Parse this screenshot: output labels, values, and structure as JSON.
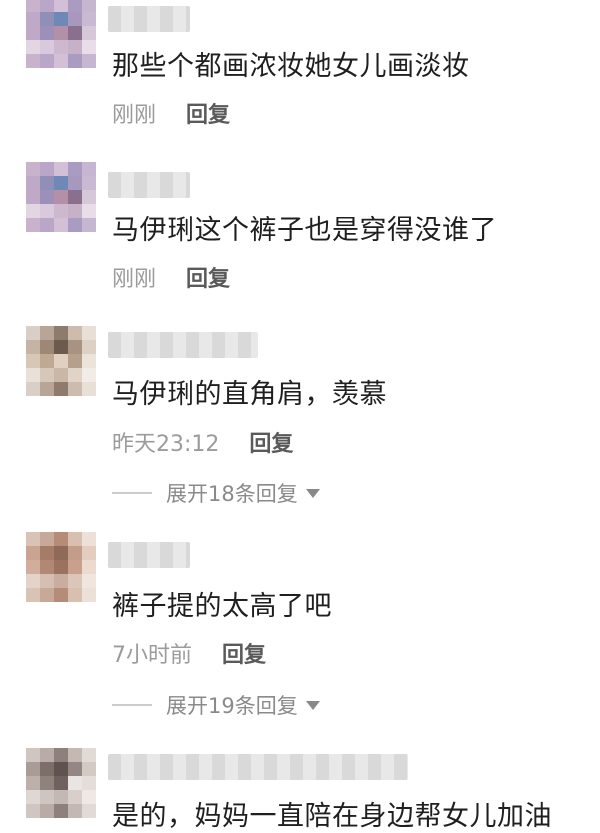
{
  "comments": [
    {
      "text": "那些个都画浓妆她女儿画淡妆",
      "time": "刚刚",
      "reply_label": "回复",
      "avatar_colors": [
        "#c9b3cc",
        "#b9a6c9",
        "#d3c0d6",
        "#a99bc2",
        "#c7b6cf",
        "#bfa9c8",
        "#8f8fb8",
        "#6e88b8",
        "#a998be",
        "#c9b9d2",
        "#c0a8c7",
        "#9c8fba",
        "#b48fa8",
        "#8a6f8f",
        "#d6c8d9",
        "#e3d6e3",
        "#d8c9dc",
        "#cdb8cf",
        "#c7b1c9",
        "#e8dde8"
      ]
    },
    {
      "text": "马伊琍这个裤子也是穿得没谁了",
      "time": "刚刚",
      "reply_label": "回复",
      "avatar_colors": [
        "#c9b3cc",
        "#b9a6c9",
        "#d3c0d6",
        "#a99bc2",
        "#c7b6cf",
        "#bfa9c8",
        "#8f8fb8",
        "#6e88b8",
        "#a998be",
        "#c9b9d2",
        "#c0a8c7",
        "#9c8fba",
        "#b48fa8",
        "#8a6f8f",
        "#d6c8d9",
        "#e3d6e3",
        "#d8c9dc",
        "#cdb8cf",
        "#c7b1c9",
        "#e8dde8"
      ]
    },
    {
      "text": "马伊琍的直角肩，羡慕",
      "time": "昨天23:12",
      "reply_label": "回复",
      "expand_label": "展开18条回复",
      "avatar_colors": [
        "#d9cfc6",
        "#b7a597",
        "#8f7b6c",
        "#cdbcad",
        "#e8dfd6",
        "#c5b3a3",
        "#9d8878",
        "#6d5a4e",
        "#a89282",
        "#ddd0c4",
        "#d8c6b6",
        "#bfa994",
        "#e1cfbf",
        "#b69f8b",
        "#ece3da",
        "#e9e1d9",
        "#d5c7ba",
        "#c9b8a8",
        "#e0d4c9",
        "#f2ece6"
      ]
    },
    {
      "text": "裤子提的太高了吧",
      "time": "7小时前",
      "reply_label": "回复",
      "expand_label": "展开19条回复",
      "avatar_colors": [
        "#d8c3b6",
        "#c7a99a",
        "#b48c78",
        "#d9bfb0",
        "#ece0d8",
        "#c9a493",
        "#a57c68",
        "#8f6a58",
        "#c49d8a",
        "#e2cdc0",
        "#d1ad9c",
        "#b28773",
        "#9b725f",
        "#c8a08c",
        "#eadad0",
        "#e3d3c8",
        "#d6bfb2",
        "#c9ad9e",
        "#dcc6b9",
        "#f1e6df"
      ]
    },
    {
      "text": "是的，妈妈一直陪在身边帮女儿加油",
      "avatar_colors": [
        "#d0c6c1",
        "#b9aca6",
        "#8e807a",
        "#c4b8b2",
        "#e2dad6",
        "#a99b95",
        "#7c6e69",
        "#5f5350",
        "#948682",
        "#d3c9c5",
        "#bdb0aa",
        "#8f817c",
        "#6f625e",
        "#a7999440",
        "#e4ddda",
        "#dfd7d3",
        "#cfc5c0",
        "#c3b8b3",
        "#d8cfcb",
        "#efe9e6"
      ]
    }
  ]
}
